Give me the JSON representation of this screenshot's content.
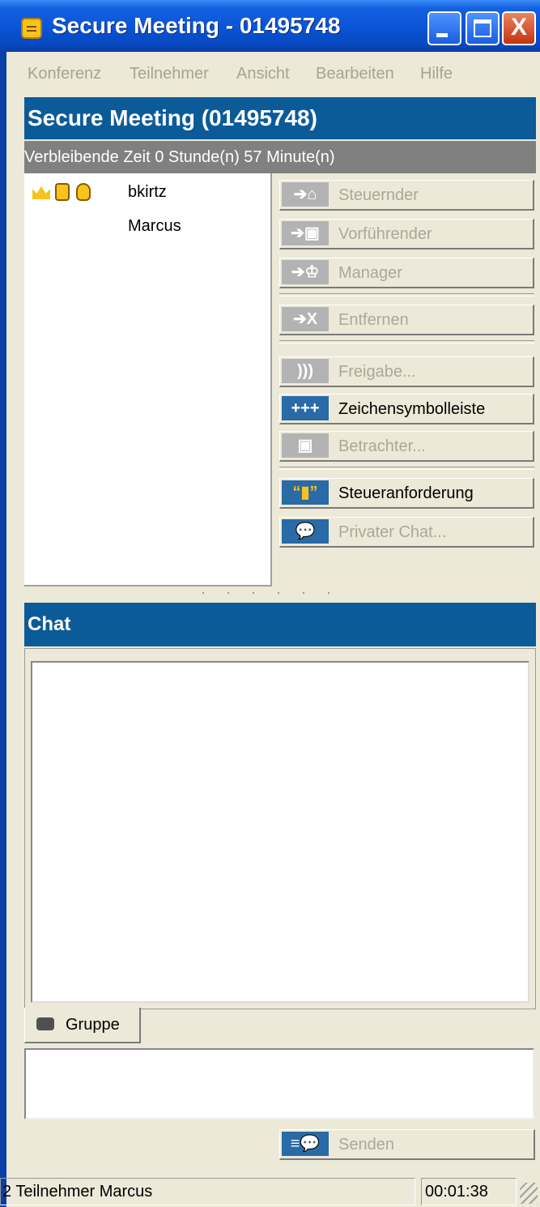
{
  "window": {
    "title": "Secure Meeting - 01495748",
    "minimize_icon": "minimize-icon",
    "maximize_icon": "maximize-icon",
    "close_glyph": "X"
  },
  "menu": {
    "items": [
      "Konferenz",
      "Teilnehmer",
      "Ansicht",
      "Bearbeiten",
      "Hilfe"
    ]
  },
  "meeting": {
    "header": "Secure Meeting (01495748)",
    "remaining_time": "Verbleibende Zeit 0 Stunde(n) 57 Minute(n)"
  },
  "participants": [
    {
      "name": "bkirtz",
      "icons": [
        "crown-icon",
        "presenter-icon",
        "mouse-icon"
      ]
    },
    {
      "name": "Marcus",
      "icons": []
    }
  ],
  "actions": [
    {
      "label": "Steuernder",
      "icon": "controller-icon",
      "enabled": false
    },
    {
      "label": "Vorführender",
      "icon": "presenter-icon",
      "enabled": false
    },
    {
      "label": "Manager",
      "icon": "crown-icon",
      "enabled": false
    },
    {
      "label": "Entfernen",
      "icon": "remove-icon",
      "enabled": false
    },
    {
      "label": "Freigabe...",
      "icon": "share-icon",
      "enabled": false
    },
    {
      "label": "Zeichensymbolleiste",
      "icon": "drawing-toolbar-icon",
      "enabled": true
    },
    {
      "label": "Betrachter...",
      "icon": "viewer-icon",
      "enabled": false
    },
    {
      "label": "Steueranforderung",
      "icon": "request-control-icon",
      "enabled": true
    },
    {
      "label": "Privater Chat...",
      "icon": "private-chat-icon",
      "enabled": false
    }
  ],
  "chat": {
    "header": "Chat",
    "tab_label": "Gruppe",
    "send_label": "Senden"
  },
  "status": {
    "participants_text": "2 Teilnehmer Marcus",
    "timer": "00:01:38"
  },
  "colors": {
    "header_blue": "#0c5b99",
    "title_blue": "#0a55d8",
    "disabled_text": "#aca899"
  }
}
